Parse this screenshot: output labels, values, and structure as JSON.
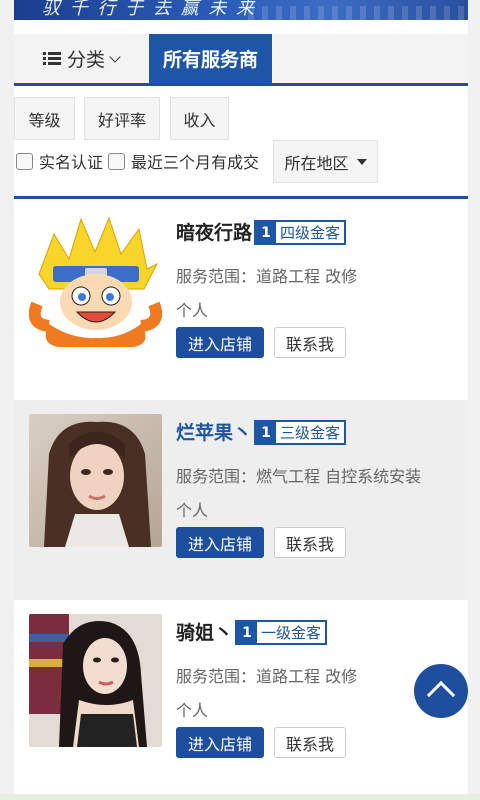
{
  "banner": {
    "slogan": "驭 千 行 于   去 赢 未 来"
  },
  "tabs": {
    "category_label": "分类",
    "all_providers_label": "所有服务商"
  },
  "filters": {
    "level": "等级",
    "rating": "好评率",
    "income": "收入",
    "verified": "实名认证",
    "recent_deals": "最近三个月有成交",
    "region": "所在地区"
  },
  "providers": [
    {
      "name": "暗夜行路",
      "level_num": "1",
      "level_label": "四级金客",
      "scope": "服务范围：道路工程 改修",
      "type": "个人",
      "shop_label": "进入店铺",
      "contact_label": "联系我"
    },
    {
      "name": "烂苹果丶",
      "level_num": "1",
      "level_label": "三级金客",
      "scope": "服务范围：燃气工程 自控系统安装",
      "type": "个人",
      "shop_label": "进入店铺",
      "contact_label": "联系我"
    },
    {
      "name": "骑姐丶",
      "level_num": "1",
      "level_label": "一级金客",
      "scope": "服务范围：道路工程 改修",
      "type": "个人",
      "shop_label": "进入店铺",
      "contact_label": "联系我"
    }
  ],
  "colors": {
    "primary": "#1e4f9f",
    "tab_active": "#1f55a6",
    "alt_row": "#eeeeee"
  },
  "icons": [
    "list-icon",
    "chevron-down-icon",
    "caret-down-icon",
    "arrow-up-icon"
  ]
}
